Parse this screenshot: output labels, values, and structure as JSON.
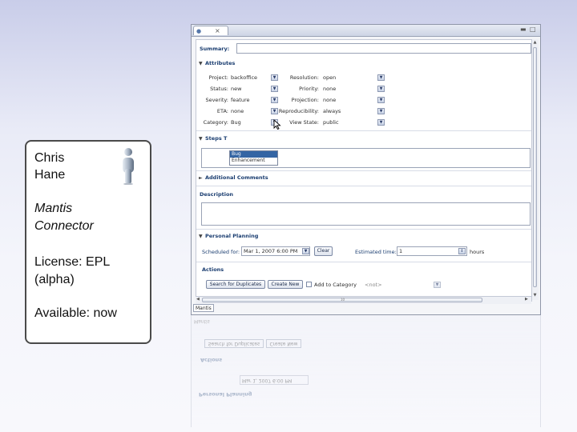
{
  "card": {
    "name_first": "Chris",
    "name_last": "Hane",
    "product_line1": "Mantis",
    "product_line2": "Connector",
    "license_line1": "License: EPL",
    "license_line2": "(alpha)",
    "available": "Available: now",
    "icon": "person-icon"
  },
  "window": {
    "tab_close": "×",
    "summary_label": "Summary:",
    "summary_value": "",
    "attributes_header": "Attributes",
    "attributes_left": [
      {
        "label": "Project:",
        "value": "backoffice"
      },
      {
        "label": "Status:",
        "value": "new"
      },
      {
        "label": "Severity:",
        "value": "feature"
      },
      {
        "label": "ETA:",
        "value": "none"
      },
      {
        "label": "Category:",
        "value": "Bug"
      }
    ],
    "attributes_right": [
      {
        "label": "Resolution:",
        "value": "open"
      },
      {
        "label": "Priority:",
        "value": "none"
      },
      {
        "label": "Projection:",
        "value": "none"
      },
      {
        "label": "Reproducibility:",
        "value": "always"
      },
      {
        "label": "View State:",
        "value": "public"
      }
    ],
    "category_options": [
      "Bug",
      "Enhancement"
    ],
    "steps_header": "Steps T",
    "additional_comments_header": "Additional Comments",
    "description_header": "Description",
    "personal_planning_header": "Personal Planning",
    "scheduled_for_label": "Scheduled for:",
    "scheduled_for_value": "Mar 1, 2007 6:00 PM",
    "clear_button": "Clear",
    "estimated_time_label": "Estimated time:",
    "estimated_time_value": "1",
    "estimated_time_unit": "hours",
    "actions_header": "Actions",
    "search_duplicates_button": "Search for Duplicates",
    "create_new_button": "Create New",
    "add_to_category_label": "Add to Category",
    "add_to_category_value": "<not>",
    "bottom_tab": "Mantis",
    "hscroll_marker": "10"
  }
}
